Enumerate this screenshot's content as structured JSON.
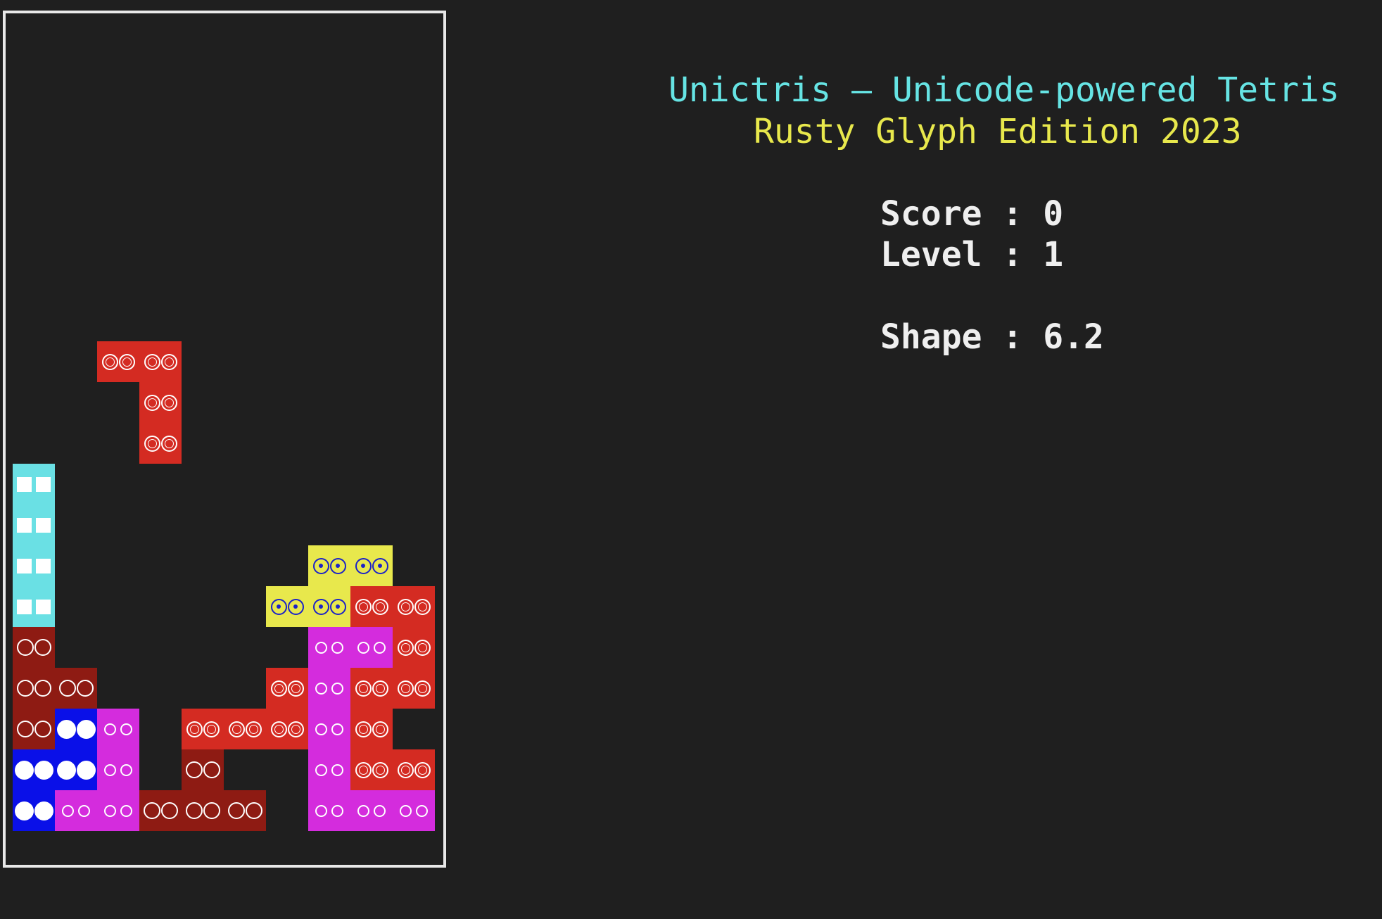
{
  "app": {
    "title": "Unictris – Unicode-powered Tetris",
    "subtitle": "Rusty Glyph Edition 2023"
  },
  "stats": {
    "score_label": "Score : ",
    "score": "0",
    "level_label": "Level : ",
    "level": "1",
    "shape_label": "Shape : ",
    "shape": "6.2"
  },
  "colors": {
    "background": "#1f1f1f",
    "border": "#e8e8e8",
    "title": "#66e4e4",
    "subtitle": "#e8e84c",
    "stats": "#efefef",
    "red": "#d42b22",
    "darkred": "#8e1b13",
    "magenta": "#d42cdd",
    "blue": "#0a10e8",
    "yellow": "#e8e84c",
    "cyan": "#6ae0e4"
  },
  "board": {
    "columns": 10,
    "rows": 20,
    "falling_piece": {
      "color": "red",
      "glyph": "ring",
      "cells": [
        [
          2,
          8
        ],
        [
          3,
          8
        ],
        [
          3,
          9
        ],
        [
          3,
          10
        ]
      ]
    },
    "locked_cells": [
      {
        "col": 0,
        "row": 11,
        "color": "cyan",
        "glyph": "square"
      },
      {
        "col": 0,
        "row": 12,
        "color": "cyan",
        "glyph": "square"
      },
      {
        "col": 0,
        "row": 13,
        "color": "cyan",
        "glyph": "square"
      },
      {
        "col": 0,
        "row": 14,
        "color": "cyan",
        "glyph": "square"
      },
      {
        "col": 7,
        "row": 13,
        "color": "yellow",
        "glyph": "bullseye"
      },
      {
        "col": 8,
        "row": 13,
        "color": "yellow",
        "glyph": "bullseye"
      },
      {
        "col": 6,
        "row": 14,
        "color": "yellow",
        "glyph": "bullseye"
      },
      {
        "col": 7,
        "row": 14,
        "color": "yellow",
        "glyph": "bullseye"
      },
      {
        "col": 8,
        "row": 14,
        "color": "red",
        "glyph": "ring"
      },
      {
        "col": 9,
        "row": 14,
        "color": "red",
        "glyph": "ring"
      },
      {
        "col": 0,
        "row": 15,
        "color": "darkred",
        "glyph": "big_ring"
      },
      {
        "col": 7,
        "row": 15,
        "color": "magenta",
        "glyph": "small_ring"
      },
      {
        "col": 8,
        "row": 15,
        "color": "magenta",
        "glyph": "small_ring"
      },
      {
        "col": 9,
        "row": 15,
        "color": "red",
        "glyph": "ring"
      },
      {
        "col": 0,
        "row": 16,
        "color": "darkred",
        "glyph": "big_ring"
      },
      {
        "col": 1,
        "row": 16,
        "color": "darkred",
        "glyph": "big_ring"
      },
      {
        "col": 6,
        "row": 16,
        "color": "red",
        "glyph": "ring"
      },
      {
        "col": 7,
        "row": 16,
        "color": "magenta",
        "glyph": "small_ring"
      },
      {
        "col": 8,
        "row": 16,
        "color": "red",
        "glyph": "ring"
      },
      {
        "col": 9,
        "row": 16,
        "color": "red",
        "glyph": "ring"
      },
      {
        "col": 0,
        "row": 17,
        "color": "darkred",
        "glyph": "big_ring"
      },
      {
        "col": 1,
        "row": 17,
        "color": "blue",
        "glyph": "dot"
      },
      {
        "col": 2,
        "row": 17,
        "color": "magenta",
        "glyph": "small_ring"
      },
      {
        "col": 4,
        "row": 17,
        "color": "red",
        "glyph": "ring"
      },
      {
        "col": 5,
        "row": 17,
        "color": "red",
        "glyph": "ring"
      },
      {
        "col": 6,
        "row": 17,
        "color": "red",
        "glyph": "ring"
      },
      {
        "col": 7,
        "row": 17,
        "color": "magenta",
        "glyph": "small_ring"
      },
      {
        "col": 8,
        "row": 17,
        "color": "red",
        "glyph": "ring"
      },
      {
        "col": 0,
        "row": 18,
        "color": "blue",
        "glyph": "dot"
      },
      {
        "col": 1,
        "row": 18,
        "color": "blue",
        "glyph": "dot"
      },
      {
        "col": 2,
        "row": 18,
        "color": "magenta",
        "glyph": "small_ring"
      },
      {
        "col": 4,
        "row": 18,
        "color": "darkred",
        "glyph": "big_ring"
      },
      {
        "col": 7,
        "row": 18,
        "color": "magenta",
        "glyph": "small_ring"
      },
      {
        "col": 8,
        "row": 18,
        "color": "red",
        "glyph": "ring"
      },
      {
        "col": 9,
        "row": 18,
        "color": "red",
        "glyph": "ring"
      },
      {
        "col": 0,
        "row": 19,
        "color": "blue",
        "glyph": "dot"
      },
      {
        "col": 1,
        "row": 19,
        "color": "magenta",
        "glyph": "small_ring"
      },
      {
        "col": 2,
        "row": 19,
        "color": "magenta",
        "glyph": "small_ring"
      },
      {
        "col": 3,
        "row": 19,
        "color": "darkred",
        "glyph": "big_ring"
      },
      {
        "col": 4,
        "row": 19,
        "color": "darkred",
        "glyph": "big_ring"
      },
      {
        "col": 5,
        "row": 19,
        "color": "darkred",
        "glyph": "big_ring"
      },
      {
        "col": 7,
        "row": 19,
        "color": "magenta",
        "glyph": "small_ring"
      },
      {
        "col": 8,
        "row": 19,
        "color": "magenta",
        "glyph": "small_ring"
      },
      {
        "col": 9,
        "row": 19,
        "color": "magenta",
        "glyph": "small_ring"
      }
    ]
  }
}
